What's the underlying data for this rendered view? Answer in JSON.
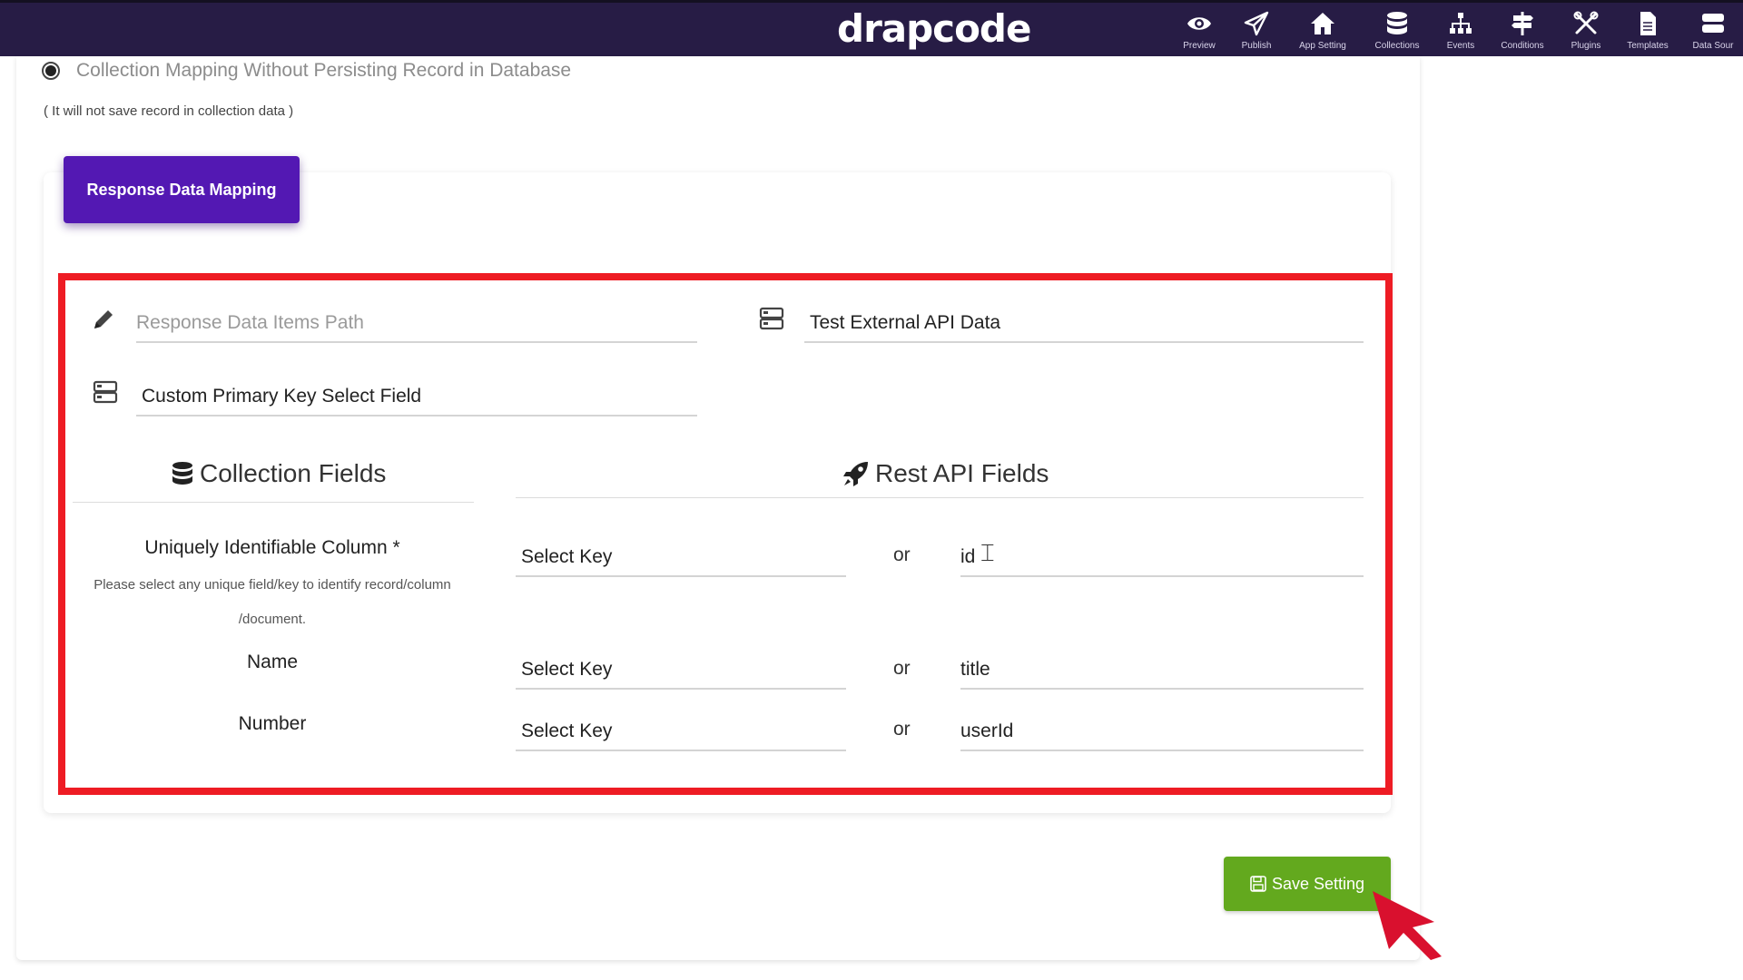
{
  "topbar": {
    "brand": "drapcode",
    "nav": [
      {
        "icon": "eye-icon",
        "label": "Preview"
      },
      {
        "icon": "paper-plane-icon",
        "label": "Publish"
      },
      {
        "icon": "home-icon",
        "label": "App Setting"
      },
      {
        "icon": "database-icon",
        "label": "Collections"
      },
      {
        "icon": "sitemap-icon",
        "label": "Events"
      },
      {
        "icon": "signpost-icon",
        "label": "Conditions"
      },
      {
        "icon": "tools-icon",
        "label": "Plugins"
      },
      {
        "icon": "file-icon",
        "label": "Templates"
      },
      {
        "icon": "server-icon",
        "label": "Data Sour"
      }
    ]
  },
  "persist_option": {
    "label": "Collection Mapping Without Persisting Record in Database",
    "note": "( It will not save record in collection data )",
    "selected": true
  },
  "mapping_button": "Response Data Mapping",
  "form": {
    "items_path_placeholder": "Response Data Items Path",
    "test_api_value": "Test External API Data",
    "primary_key_value": "Custom Primary Key Select Field",
    "collection_fields_title": "Collection Fields",
    "rest_api_fields_title": "Rest API Fields",
    "rows": [
      {
        "label": "Uniquely Identifiable Column *",
        "help_line1": "Please select any unique field/key to identify record/column",
        "help_line2": "/document.",
        "select_key": "Select Key",
        "or": "or",
        "api_value": "id"
      },
      {
        "label": "Name",
        "select_key": "Select Key",
        "or": "or",
        "api_value": "title"
      },
      {
        "label": "Number",
        "select_key": "Select Key",
        "or": "or",
        "api_value": "userId"
      }
    ]
  },
  "save_button": "Save Setting",
  "colors": {
    "topbar": "#271c45",
    "primary_purple": "#5318b3",
    "highlight_red": "#ee1c24",
    "save_green": "#63a91e"
  }
}
